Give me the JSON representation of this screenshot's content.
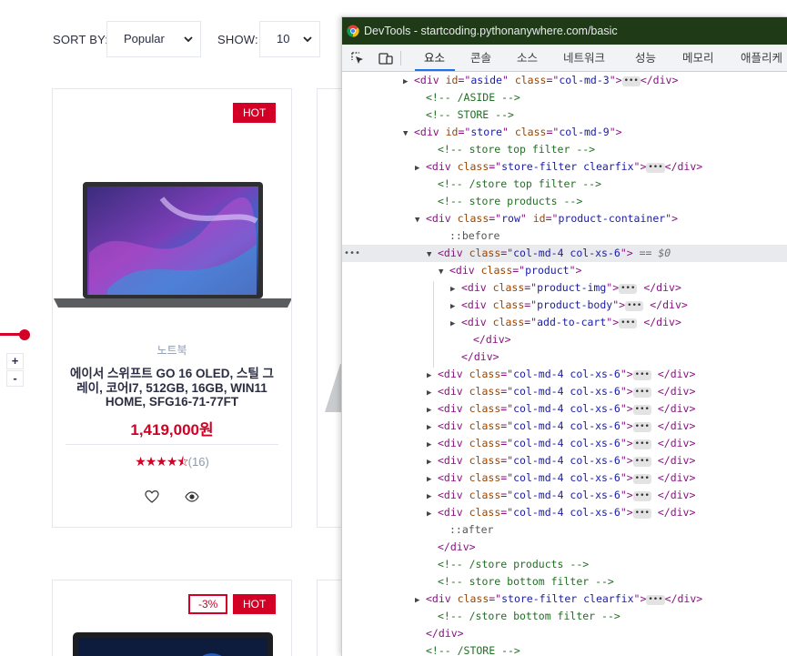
{
  "filters": {
    "sort_label": "SORT BY:",
    "sort_value": "Popular",
    "show_label": "SHOW:",
    "show_value": "10"
  },
  "qty": {
    "plus": "+",
    "minus": "-"
  },
  "products": [
    {
      "badges": [
        "HOT"
      ],
      "category": "노트북",
      "name": "에이서 스위프트 GO 16 OLED, 스틸 그레이, 코어I7, 512GB, 16GB, WIN11 HOME, SFG16-71-77FT",
      "price": "1,419,000원",
      "rating": 4.5,
      "stars": "★★★★⯪",
      "reviews": "(16)"
    },
    {
      "badges": [
        "-3%",
        "HOT"
      ]
    }
  ],
  "devtools": {
    "title": "DevTools - startcoding.pythonanywhere.com/basic",
    "tabs": [
      "요소",
      "콘솔",
      "소스",
      "네트워크",
      "성능",
      "메모리",
      "애플리케"
    ],
    "active_tab": "요소",
    "tree": [
      {
        "indent": 5,
        "arrow": "▶",
        "html": "<span class='tag'>&lt;div </span><span class='attr'>id</span><span class='tag'>=\"</span><span class='val'>aside</span><span class='tag'>\" </span><span class='attr'>class</span><span class='tag'>=\"</span><span class='val'>col-md-3</span><span class='tag'>\"&gt;</span><span class='ell'>•••</span><span class='tag'>&lt;/div&gt;</span>"
      },
      {
        "indent": 6,
        "arrow": "",
        "html": "<span class='cmt'>&lt;!-- /ASIDE --&gt;</span>"
      },
      {
        "indent": 6,
        "arrow": "",
        "html": "<span class='cmt'>&lt;!-- STORE --&gt;</span>"
      },
      {
        "indent": 5,
        "arrow": "▼",
        "html": "<span class='tag'>&lt;div </span><span class='attr'>id</span><span class='tag'>=\"</span><span class='val'>store</span><span class='tag'>\" </span><span class='attr'>class</span><span class='tag'>=\"</span><span class='val'>col-md-9</span><span class='tag'>\"&gt;</span>"
      },
      {
        "indent": 7,
        "arrow": "",
        "html": "<span class='cmt'>&lt;!-- store top filter --&gt;</span>"
      },
      {
        "indent": 6,
        "arrow": "▶",
        "html": "<span class='tag'>&lt;div </span><span class='attr'>class</span><span class='tag'>=\"</span><span class='val'>store-filter clearfix</span><span class='tag'>\"&gt;</span><span class='ell'>•••</span><span class='tag'>&lt;/div&gt;</span>"
      },
      {
        "indent": 7,
        "arrow": "",
        "html": "<span class='cmt'>&lt;!-- /store top filter --&gt;</span>"
      },
      {
        "indent": 7,
        "arrow": "",
        "html": "<span class='cmt'>&lt;!-- store products --&gt;</span>"
      },
      {
        "indent": 6,
        "arrow": "▼",
        "html": "<span class='tag'>&lt;div </span><span class='attr'>class</span><span class='tag'>=\"</span><span class='val'>row</span><span class='tag'>\" </span><span class='attr'>id</span><span class='tag'>=\"</span><span class='val'>product-container</span><span class='tag'>\"&gt;</span>"
      },
      {
        "indent": 8,
        "arrow": "",
        "html": "<span class='pseudo'>::before</span>"
      },
      {
        "indent": 7,
        "arrow": "▼",
        "sel": true,
        "html": "<span class='tag'>&lt;div </span><span class='attr'>class</span><span class='tag'>=\"</span><span class='val'>col-md-4 col-xs-6</span><span class='tag'>\"&gt;</span> <span class='eq0'>== $0</span>"
      },
      {
        "indent": 8,
        "arrow": "▼",
        "html": "<span class='tag'>&lt;div </span><span class='attr'>class</span><span class='tag'>=\"</span><span class='val'>product</span><span class='tag'>\"&gt;</span>"
      },
      {
        "indent": 9,
        "arrow": "▶",
        "html": "<span class='tag'>&lt;div </span><span class='attr'>class</span><span class='tag'>=\"</span><span class='val'>product-img</span><span class='tag'>\"&gt;</span><span class='ell'>•••</span><span class='tag'> &lt;/div&gt;</span>"
      },
      {
        "indent": 9,
        "arrow": "▶",
        "html": "<span class='tag'>&lt;div </span><span class='attr'>class</span><span class='tag'>=\"</span><span class='val'>product-body</span><span class='tag'>\"&gt;</span><span class='ell'>•••</span><span class='tag'> &lt;/div&gt;</span>"
      },
      {
        "indent": 9,
        "arrow": "▶",
        "html": "<span class='tag'>&lt;div </span><span class='attr'>class</span><span class='tag'>=\"</span><span class='val'>add-to-cart</span><span class='tag'>\"&gt;</span><span class='ell'>•••</span><span class='tag'> &lt;/div&gt;</span>"
      },
      {
        "indent": 10,
        "arrow": "",
        "html": "<span class='tag'>&lt;/div&gt;</span>"
      },
      {
        "indent": 9,
        "arrow": "",
        "html": "<span class='tag'>&lt;/div&gt;</span>"
      },
      {
        "indent": 7,
        "arrow": "▶",
        "html": "<span class='tag'>&lt;div </span><span class='attr'>class</span><span class='tag'>=\"</span><span class='val'>col-md-4 col-xs-6</span><span class='tag'>\"&gt;</span><span class='ell'>•••</span><span class='tag'> &lt;/div&gt;</span>"
      },
      {
        "indent": 7,
        "arrow": "▶",
        "html": "<span class='tag'>&lt;div </span><span class='attr'>class</span><span class='tag'>=\"</span><span class='val'>col-md-4 col-xs-6</span><span class='tag'>\"&gt;</span><span class='ell'>•••</span><span class='tag'> &lt;/div&gt;</span>"
      },
      {
        "indent": 7,
        "arrow": "▶",
        "html": "<span class='tag'>&lt;div </span><span class='attr'>class</span><span class='tag'>=\"</span><span class='val'>col-md-4 col-xs-6</span><span class='tag'>\"&gt;</span><span class='ell'>•••</span><span class='tag'> &lt;/div&gt;</span>"
      },
      {
        "indent": 7,
        "arrow": "▶",
        "html": "<span class='tag'>&lt;div </span><span class='attr'>class</span><span class='tag'>=\"</span><span class='val'>col-md-4 col-xs-6</span><span class='tag'>\"&gt;</span><span class='ell'>•••</span><span class='tag'> &lt;/div&gt;</span>"
      },
      {
        "indent": 7,
        "arrow": "▶",
        "html": "<span class='tag'>&lt;div </span><span class='attr'>class</span><span class='tag'>=\"</span><span class='val'>col-md-4 col-xs-6</span><span class='tag'>\"&gt;</span><span class='ell'>•••</span><span class='tag'> &lt;/div&gt;</span>"
      },
      {
        "indent": 7,
        "arrow": "▶",
        "html": "<span class='tag'>&lt;div </span><span class='attr'>class</span><span class='tag'>=\"</span><span class='val'>col-md-4 col-xs-6</span><span class='tag'>\"&gt;</span><span class='ell'>•••</span><span class='tag'> &lt;/div&gt;</span>"
      },
      {
        "indent": 7,
        "arrow": "▶",
        "html": "<span class='tag'>&lt;div </span><span class='attr'>class</span><span class='tag'>=\"</span><span class='val'>col-md-4 col-xs-6</span><span class='tag'>\"&gt;</span><span class='ell'>•••</span><span class='tag'> &lt;/div&gt;</span>"
      },
      {
        "indent": 7,
        "arrow": "▶",
        "html": "<span class='tag'>&lt;div </span><span class='attr'>class</span><span class='tag'>=\"</span><span class='val'>col-md-4 col-xs-6</span><span class='tag'>\"&gt;</span><span class='ell'>•••</span><span class='tag'> &lt;/div&gt;</span>"
      },
      {
        "indent": 7,
        "arrow": "▶",
        "html": "<span class='tag'>&lt;div </span><span class='attr'>class</span><span class='tag'>=\"</span><span class='val'>col-md-4 col-xs-6</span><span class='tag'>\"&gt;</span><span class='ell'>•••</span><span class='tag'> &lt;/div&gt;</span>"
      },
      {
        "indent": 8,
        "arrow": "",
        "html": "<span class='pseudo'>::after</span>"
      },
      {
        "indent": 7,
        "arrow": "",
        "html": "<span class='tag'>&lt;/div&gt;</span>"
      },
      {
        "indent": 7,
        "arrow": "",
        "html": "<span class='cmt'>&lt;!-- /store products --&gt;</span>"
      },
      {
        "indent": 7,
        "arrow": "",
        "html": "<span class='cmt'>&lt;!-- store bottom filter --&gt;</span>"
      },
      {
        "indent": 6,
        "arrow": "▶",
        "html": "<span class='tag'>&lt;div </span><span class='attr'>class</span><span class='tag'>=\"</span><span class='val'>store-filter clearfix</span><span class='tag'>\"&gt;</span><span class='ell'>•••</span><span class='tag'>&lt;/div&gt;</span>"
      },
      {
        "indent": 7,
        "arrow": "",
        "html": "<span class='cmt'>&lt;!-- /store bottom filter --&gt;</span>"
      },
      {
        "indent": 6,
        "arrow": "",
        "html": "<span class='tag'>&lt;/div&gt;</span>"
      },
      {
        "indent": 6,
        "arrow": "",
        "html": "<span class='cmt'>&lt;!-- /STORE --&gt;</span>"
      }
    ]
  },
  "colors": {
    "accent": "#D10024",
    "devtools_titlebar": "#1F3A17",
    "tab_highlight": "#1A73E8"
  }
}
